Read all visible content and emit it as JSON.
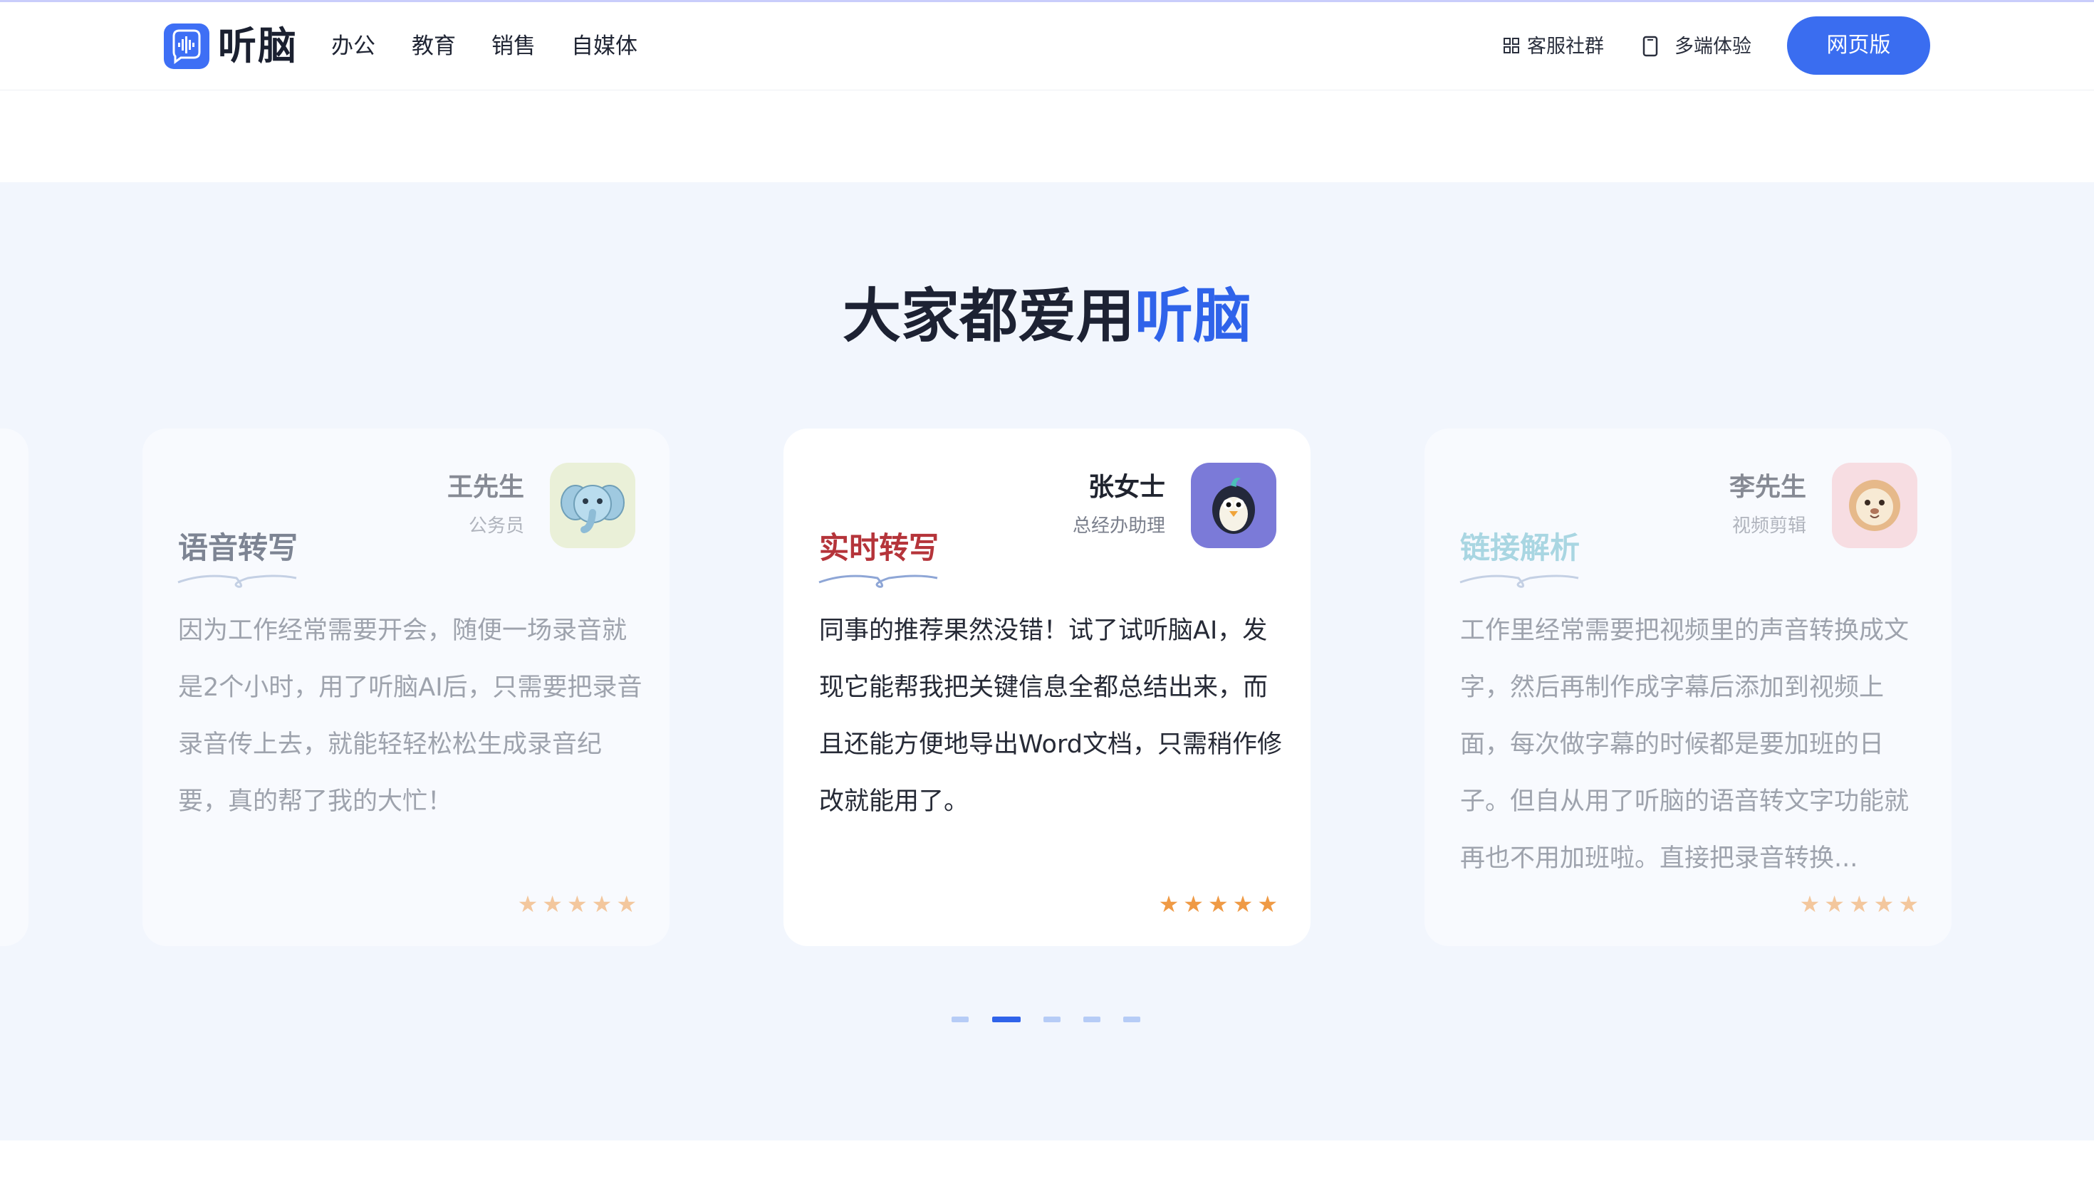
{
  "brand": {
    "name": "听脑",
    "accent": "#3a6df0"
  },
  "nav": {
    "items": [
      "办公",
      "教育",
      "销售",
      "自媒体"
    ]
  },
  "header": {
    "community": "客服社群",
    "multi_device": "多端体验",
    "web_button": "网页版"
  },
  "section": {
    "title_prefix": "大家都爱用",
    "title_highlight": "听脑"
  },
  "testimonials": [
    {
      "name": "王先生",
      "role": "公务员",
      "tag": "语音转写",
      "tag_color": "#7d8493",
      "avatar": "elephant-avatar",
      "quote": "因为工作经常需要开会，随便一场录音就是2个小时，用了听脑AI后，只需要把录音录音传上去，就能轻轻松松生成录音纪要，真的帮了我的大忙！",
      "rating": "5 of 5"
    },
    {
      "name": "张女士",
      "role": "总经办助理",
      "tag": "实时转写",
      "tag_color": "#b5343a",
      "avatar": "penguin-avatar",
      "quote": "同事的推荐果然没错！试了试听脑AI，发现它能帮我把关键信息全都总结出来，而且还能方便地导出Word文档，只需稍作修改就能用了。",
      "rating": "5 of 5"
    },
    {
      "name": "李先生",
      "role": "视频剪辑",
      "tag": "链接解析",
      "tag_color": "#a9d6e2",
      "avatar": "lion-avatar",
      "quote": "工作里经常需要把视频里的声音转换成文字，然后再制作成字幕后添加到视频上面，每次做字幕的时候都是要加班的日子。但自从用了听脑的语音转文字功能就再也不用加班啦。直接把录音转换...",
      "rating": "5 of 5"
    }
  ],
  "pager": {
    "count": 5,
    "active_index": 2
  },
  "stars_glyph": "★★★★★"
}
